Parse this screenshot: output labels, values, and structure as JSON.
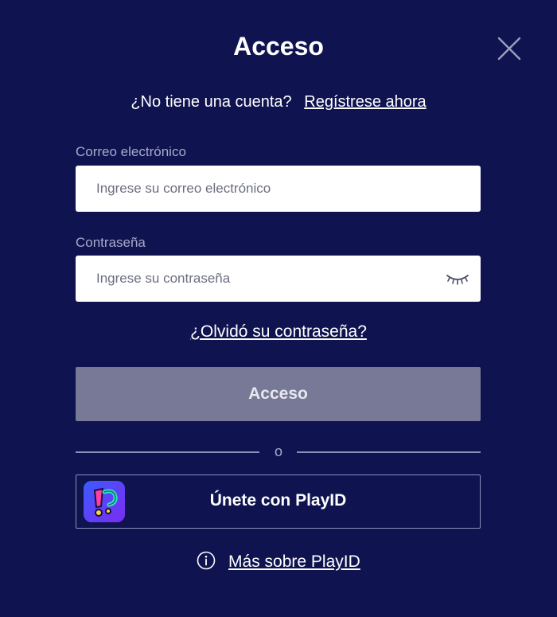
{
  "dialog": {
    "title": "Acceso"
  },
  "signup": {
    "question": "¿No tiene una cuenta?",
    "link": "Regístrese ahora"
  },
  "email": {
    "label": "Correo electrónico",
    "placeholder": "Ingrese su correo electrónico",
    "value": ""
  },
  "password": {
    "label": "Contraseña",
    "placeholder": "Ingrese su contraseña",
    "value": ""
  },
  "forgot_link": "¿Olvidó su contraseña?",
  "login_button": "Acceso",
  "divider": "o",
  "playid": {
    "button": "Únete con PlayID",
    "more_link": "Más sobre PlayID"
  },
  "icons": {
    "close": "close-icon",
    "eye": "eye-closed-icon",
    "logo": "playid-logo",
    "info": "info-icon"
  },
  "colors": {
    "background": "#0f1450",
    "button_disabled": "#787897",
    "label": "#a7a9c9",
    "input_bg": "#ffffff"
  }
}
